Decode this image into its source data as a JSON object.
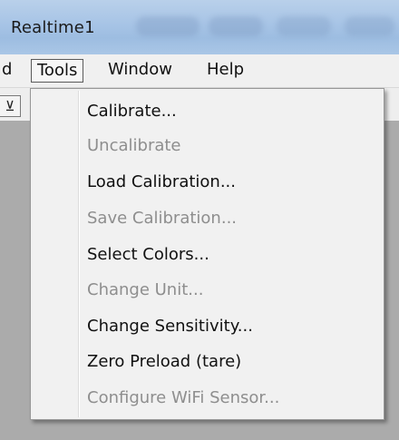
{
  "window": {
    "title": "Realtime1"
  },
  "menubar": {
    "items": [
      {
        "label": "d"
      },
      {
        "label": "Tools"
      },
      {
        "label": "Window"
      },
      {
        "label": "Help"
      }
    ]
  },
  "toolbar": {
    "partial_button_icon": "cursor-icon",
    "partial_button_glyph": "⊻"
  },
  "tools_menu": {
    "items": [
      {
        "label": "Calibrate...",
        "enabled": true
      },
      {
        "label": "Uncalibrate",
        "enabled": false
      },
      {
        "label": "Load Calibration...",
        "enabled": true
      },
      {
        "label": "Save Calibration...",
        "enabled": false
      },
      {
        "label": "Select Colors...",
        "enabled": true
      },
      {
        "label": "Change Unit...",
        "enabled": false
      },
      {
        "label": "Change Sensitivity...",
        "enabled": true
      },
      {
        "label": "Zero Preload (tare)",
        "enabled": true
      },
      {
        "label": "Configure WiFi Sensor...",
        "enabled": false
      }
    ]
  }
}
